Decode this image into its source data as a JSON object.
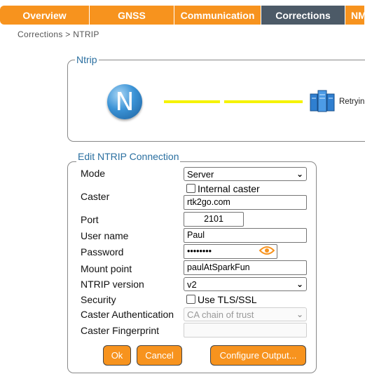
{
  "nav": {
    "tabs": [
      {
        "label": "Overview"
      },
      {
        "label": "GNSS"
      },
      {
        "label": "Communication"
      },
      {
        "label": "Corrections"
      },
      {
        "label": "NM"
      }
    ],
    "active_tab": "Corrections"
  },
  "breadcrumb": "Corrections > NTRIP",
  "status": {
    "legend": "Ntrip",
    "logo_letter": "N",
    "server_status": "Retryin",
    "line_color": "#f5f300"
  },
  "form": {
    "legend": "Edit NTRIP Connection",
    "mode": {
      "label": "Mode",
      "value": "Server"
    },
    "caster": {
      "label": "Caster",
      "internal_label": "Internal caster",
      "internal_checked": false,
      "value": "rtk2go.com"
    },
    "port": {
      "label": "Port",
      "value": "2101"
    },
    "username": {
      "label": "User name",
      "value": "Paul"
    },
    "password": {
      "label": "Password",
      "value": "••••••••"
    },
    "mountpoint": {
      "label": "Mount point",
      "value": "paulAtSparkFun"
    },
    "version": {
      "label": "NTRIP version",
      "value": "v2"
    },
    "security": {
      "label": "Security",
      "tls_label": "Use TLS/SSL",
      "tls_checked": false
    },
    "auth": {
      "label": "Caster Authentication",
      "value": "CA chain of trust",
      "disabled": true
    },
    "fingerprint": {
      "label": "Caster Fingerprint",
      "value": "",
      "disabled": true
    },
    "buttons": {
      "ok": "Ok",
      "cancel": "Cancel",
      "configure": "Configure Output..."
    }
  },
  "colors": {
    "accent": "#f7931e",
    "active_tab": "#4c5a67",
    "legend": "#2a6fa0"
  }
}
